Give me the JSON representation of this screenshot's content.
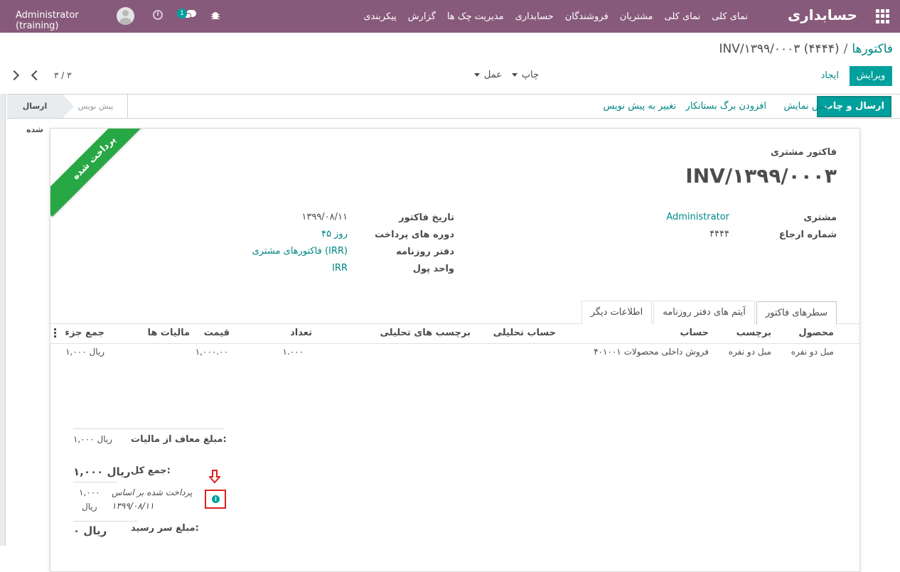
{
  "navbar": {
    "brand": "حسابداری",
    "menu": [
      "نمای کلی",
      "نمای کلی",
      "مشتریان",
      "فروشندگان",
      "حسابداری",
      "مدیریت چک ها",
      "گزارش",
      "پیکربندی"
    ],
    "user_label": "Administrator (training)",
    "chat_count": "1"
  },
  "breadcrumb": {
    "parent": "فاکتورها",
    "separator": "/",
    "current": "INV/۱۳۹۹/۰۰۰۳ (۴۴۴۴)"
  },
  "controls": {
    "edit_label": "ویرایش",
    "create_label": "ایجاد",
    "print_label": "چاپ",
    "action_label": "عمل",
    "pager_value": "۳ / ۳"
  },
  "statusbar": {
    "send_print_label": "ارسال و چاپ",
    "preview_label": "پیش نمایش",
    "add_credit_label": "افزودن برگ بستانکار",
    "reset_draft_label": "تغییر به پیش نویس",
    "stage_posted": "ارسال شده",
    "stage_draft": "پیش نویس"
  },
  "sheet": {
    "ribbon": "پرداخت شده",
    "subtitle": "فاکتور مشتری",
    "number": "INV/۱۳۹۹/۰۰۰۳",
    "customer_label": "مشتری",
    "customer_value": "Administrator",
    "reference_label": "شماره ارجاع",
    "reference_value": "۴۴۴۴",
    "invoice_date_label": "تاریخ فاکتور",
    "invoice_date_value": "۱۳۹۹/۰۸/۱۱",
    "payment_terms_label": "دوره های پرداخت",
    "payment_terms_value": "۴۵ روز",
    "journal_label": "دفتر روزنامه",
    "journal_value": "فاکتورهای مشتری (IRR)",
    "currency_label": "واحد پول",
    "currency_value": "IRR"
  },
  "tabs": [
    "سطرهای فاکتور",
    "آیتم های دفتر روزنامه",
    "اطلاعات دیگر"
  ],
  "table": {
    "headers": [
      "محصول",
      "برچسب",
      "حساب",
      "حساب تحلیلی",
      "برچسب های تحلیلی",
      "تعداد",
      "قیمت",
      "مالیات ها",
      "جمع جزء"
    ],
    "rows": [
      [
        "مبل دو نفره",
        "مبل دو نفره",
        "۴۰۱۰۰۱ فروش داخلی محصولات",
        "",
        "",
        "۱.۰۰۰",
        "۱,۰۰۰.۰۰",
        "",
        "۱,۰۰۰ ریال"
      ]
    ]
  },
  "totals": {
    "untaxed_label": "مبلغ معاف از مالیات:",
    "untaxed_value": "۱,۰۰۰ ریال",
    "total_label": "جمع کل:",
    "total_value": "۱,۰۰۰ ریال",
    "paid_note_line1": "پرداخت شده بر اساس",
    "paid_note_line2": "۱۳۹۹/۰۸/۱۱",
    "paid_amount_line1": "۱,۰۰۰",
    "paid_amount_line2": "ریال",
    "due_label": "مبلغ سر رسید:",
    "due_value": "۰ ریال"
  },
  "colors": {
    "navbar": "#875a7b",
    "primary": "#00a09d",
    "link": "#008784",
    "ribbon": "#28a745",
    "highlight": "#e02020"
  }
}
